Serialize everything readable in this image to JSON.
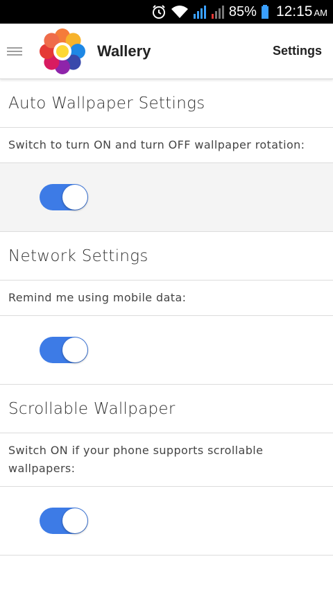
{
  "status_bar": {
    "battery_percent": "85%",
    "time": "12:15",
    "am_pm": "AM",
    "icons": [
      "alarm-icon",
      "wifi-icon",
      "signal-icon",
      "signal-weak-icon",
      "battery-icon"
    ]
  },
  "app_bar": {
    "title": "Wallery",
    "action_label": "Settings"
  },
  "sections": [
    {
      "heading": "Auto Wallpaper Settings",
      "description": "Switch to turn ON and turn OFF wallpaper rotation:",
      "switch_on": true
    },
    {
      "heading": "Network Settings",
      "description": "Remind me using mobile data:",
      "switch_on": true
    },
    {
      "heading": "Scrollable Wallpaper",
      "description": "Switch ON if your phone supports scrollable wallpapers:",
      "switch_on": true
    }
  ],
  "colors": {
    "switch_on": "#3d7be6",
    "status_bar": "#000000",
    "divider": "#dcdcdc"
  }
}
